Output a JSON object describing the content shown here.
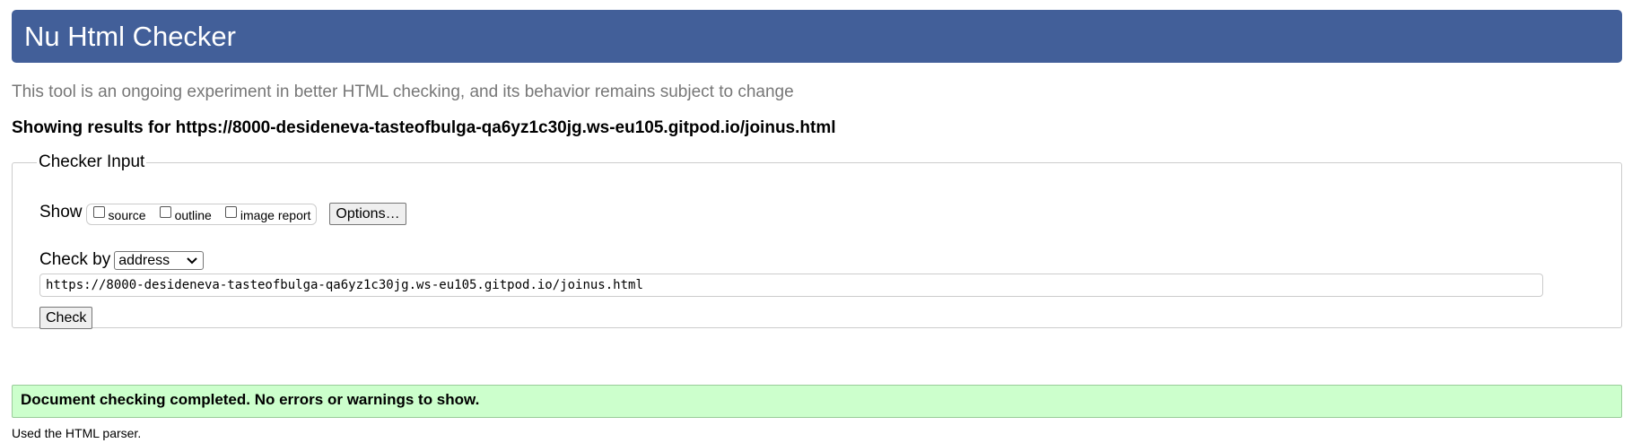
{
  "header": {
    "title": "Nu Html Checker",
    "background_color": "#425f99"
  },
  "intro": {
    "text": "This tool is an ongoing experiment in better HTML checking, and its behavior remains subject to change"
  },
  "showing": {
    "text": "Showing results for https://8000-desideneva-tasteofbulga-qa6yz1c30jg.ws-eu105.gitpod.io/joinus.html"
  },
  "checker": {
    "legend": "Checker Input",
    "show_label": "Show",
    "options": [
      {
        "label": "source",
        "checked": false
      },
      {
        "label": "outline",
        "checked": false
      },
      {
        "label": "image report",
        "checked": false
      }
    ],
    "options_button": "Options…",
    "checkby_label": "Check by",
    "checkby_selected": "address",
    "url_value": "https://8000-desideneva-tasteofbulga-qa6yz1c30jg.ws-eu105.gitpod.io/joinus.html",
    "check_button": "Check"
  },
  "result": {
    "message": "Document checking completed. No errors or warnings to show.",
    "background_color": "#ccffcc",
    "parser_note": "Used the HTML parser."
  }
}
